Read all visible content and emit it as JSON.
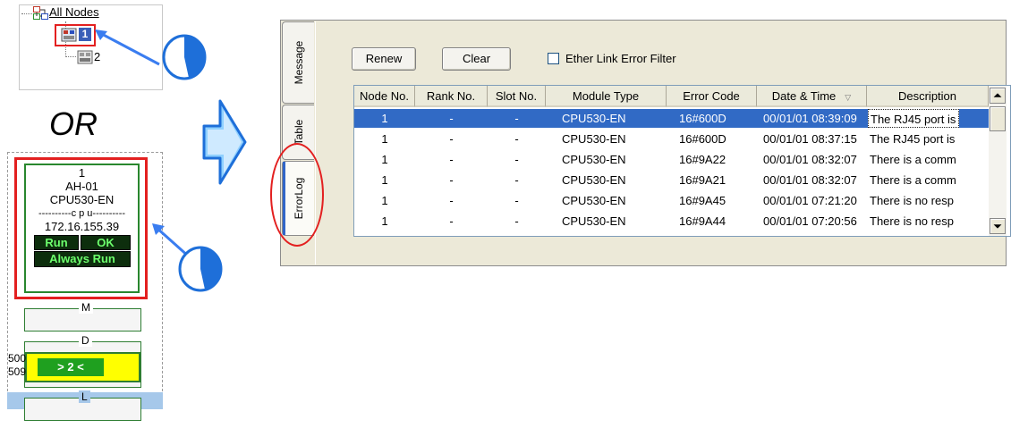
{
  "tree": {
    "root_label": "All Nodes",
    "nodes": [
      {
        "label": "1",
        "selected": true
      },
      {
        "label": "2",
        "selected": false
      }
    ]
  },
  "or_text": "OR",
  "device": {
    "node_no": "1",
    "model": "AH-01",
    "cpu": "CPU530-EN",
    "cpu_divider": "----------c p u----------",
    "ip": "172.16.155.39",
    "status_run": "Run",
    "status_ok": "OK",
    "mode": "Always Run",
    "slots": [
      {
        "letter": "M"
      },
      {
        "letter": "D"
      },
      {
        "letter": "L"
      }
    ],
    "d_slot_value": "> 2 <",
    "d_slot_num_top": "500",
    "d_slot_num_bottom": "509"
  },
  "window": {
    "tabs": [
      "Message",
      "Table",
      "ErrorLog"
    ],
    "active_tab": "ErrorLog",
    "renew_label": "Renew",
    "clear_label": "Clear",
    "filter_label": "Ether Link Error Filter",
    "filter_checked": false,
    "columns": [
      "Node No.",
      "Rank No.",
      "Slot No.",
      "Module Type",
      "Error Code",
      "Date & Time",
      "Description"
    ],
    "rows": [
      {
        "node": "1",
        "rank": "-",
        "slot": "-",
        "module": "CPU530-EN",
        "code": "16#600D",
        "datetime": "00/01/01 08:39:09",
        "desc": "The RJ45 port is"
      },
      {
        "node": "1",
        "rank": "-",
        "slot": "-",
        "module": "CPU530-EN",
        "code": "16#600D",
        "datetime": "00/01/01 08:37:15",
        "desc": "The RJ45 port is"
      },
      {
        "node": "1",
        "rank": "-",
        "slot": "-",
        "module": "CPU530-EN",
        "code": "16#9A22",
        "datetime": "00/01/01 08:32:07",
        "desc": "There is a comm"
      },
      {
        "node": "1",
        "rank": "-",
        "slot": "-",
        "module": "CPU530-EN",
        "code": "16#9A21",
        "datetime": "00/01/01 08:32:07",
        "desc": "There is a comm"
      },
      {
        "node": "1",
        "rank": "-",
        "slot": "-",
        "module": "CPU530-EN",
        "code": "16#9A45",
        "datetime": "00/01/01 07:21:20",
        "desc": "There is no resp"
      },
      {
        "node": "1",
        "rank": "-",
        "slot": "-",
        "module": "CPU530-EN",
        "code": "16#9A44",
        "datetime": "00/01/01 07:20:56",
        "desc": "There is no resp"
      }
    ]
  },
  "colors": {
    "highlight_red": "#e32020",
    "selection_blue": "#316ac5",
    "status_green": "#6dff6d",
    "slot_yellow": "#ffff00",
    "arrow_blue": "#3a7df0"
  }
}
